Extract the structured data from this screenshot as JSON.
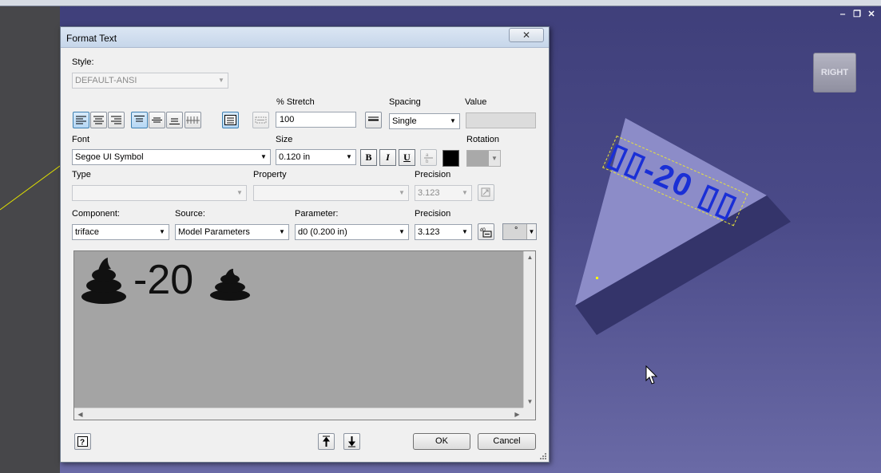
{
  "dialog": {
    "title": "Format Text",
    "close_glyph": "✕",
    "style": {
      "label": "Style:",
      "value": "DEFAULT-ANSI"
    },
    "stretch": {
      "label": "% Stretch",
      "value": "100"
    },
    "spacing": {
      "label": "Spacing",
      "value": "Single"
    },
    "value_label": "Value",
    "font": {
      "label": "Font",
      "value": "Segoe UI Symbol"
    },
    "size": {
      "label": "Size",
      "value": "0.120 in"
    },
    "format_buttons": {
      "bold": "B",
      "italic": "I",
      "underline": "U"
    },
    "rotation_label": "Rotation",
    "type_label": "Type",
    "property_label": "Property",
    "precision1": {
      "label": "Precision",
      "value": "3.123"
    },
    "component": {
      "label": "Component:",
      "value": "triface"
    },
    "source": {
      "label": "Source:",
      "value": "Model Parameters"
    },
    "parameter": {
      "label": "Parameter:",
      "value": "d0 (0.200 in)"
    },
    "precision2": {
      "label": "Precision",
      "value": "3.123"
    },
    "symbol_value": "°",
    "preview": {
      "text": "-20"
    },
    "buttons": {
      "ok": "OK",
      "cancel": "Cancel"
    }
  },
  "viewport": {
    "viewcube_label": "RIGHT",
    "model_text": "▯▯-20 ▯▯"
  },
  "colors": {
    "dialog_bg": "#f0f0f0",
    "viewport_bg": "#4a4a88",
    "model_text": "#1a2fd6",
    "preview_bg": "#a4a4a4"
  }
}
